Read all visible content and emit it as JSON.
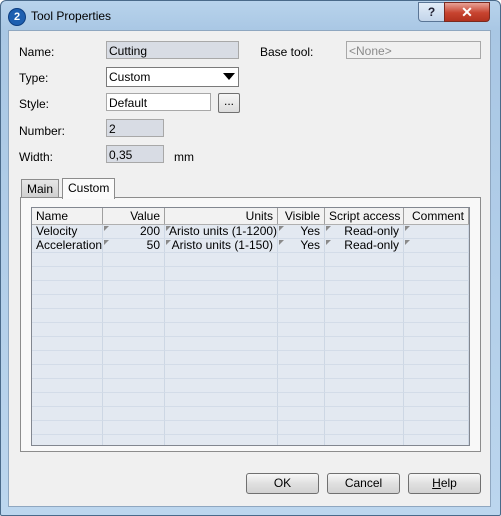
{
  "window": {
    "title": "Tool Properties",
    "help_glyph": "?",
    "close_glyph": "✕",
    "app_icon_glyph": "2"
  },
  "form": {
    "name_label": "Name:",
    "name_value": "Cutting",
    "base_tool_label": "Base tool:",
    "base_tool_value": "<None>",
    "type_label": "Type:",
    "type_value": "Custom",
    "style_label": "Style:",
    "style_value": "Default",
    "style_browse_label": "...",
    "number_label": "Number:",
    "number_value": "2",
    "width_label": "Width:",
    "width_value": "0,35",
    "width_unit": "mm"
  },
  "tabs": [
    {
      "label": "Main",
      "active": false
    },
    {
      "label": "Custom",
      "active": true
    }
  ],
  "table": {
    "columns": [
      "Name",
      "Value",
      "Units",
      "Visible",
      "Script access",
      "Comment"
    ],
    "rows": [
      [
        "Velocity",
        "200",
        "Aristo units (1-1200)",
        "Yes",
        "Read-only",
        ""
      ],
      [
        "Acceleration",
        "50",
        "Aristo units (1-150)",
        "Yes",
        "Read-only",
        ""
      ]
    ]
  },
  "buttons": {
    "ok": "OK",
    "cancel": "Cancel",
    "help": "Help"
  },
  "icons": {
    "app": "app-logo-icon",
    "dropdown": "chevron-down-icon"
  }
}
